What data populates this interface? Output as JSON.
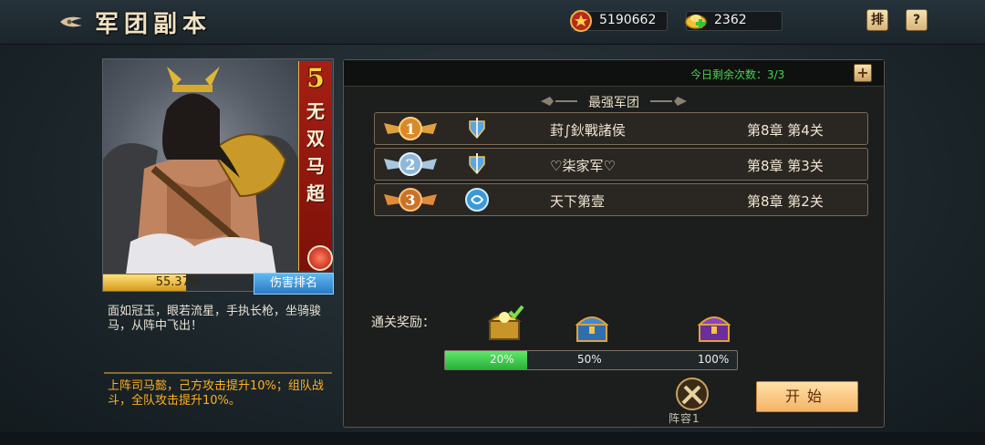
{
  "header": {
    "title": "军团副本",
    "resources": [
      {
        "icon": "rank-medal-icon",
        "value": "5190662"
      },
      {
        "icon": "gold-ingot-plus-icon",
        "value": "2362"
      }
    ],
    "buttons": {
      "rank": "排",
      "help": "?"
    }
  },
  "hero": {
    "rank_number": "5",
    "name": "无双马超",
    "damage_progress_percent": 55.37,
    "damage_text": "55.37%",
    "damage_rank_button": "伤害排名",
    "description": "面如冠玉，眼若流星，手执长枪，坐骑骏马，从阵中飞出！",
    "bonus": "上阵司马懿，己方攻击提升10%；组队战斗，全队攻击提升10%。"
  },
  "panel": {
    "remaining_label": "今日剩余次数：3/3",
    "add_button": "+",
    "section_title": "最强军团",
    "rankings": [
      {
        "rank": "1",
        "name": "葑∫鈥戰諸侯",
        "stage": "第8章 第4关",
        "medal_color": "#d9892c"
      },
      {
        "rank": "2",
        "name": "♡柒家军♡",
        "stage": "第8章 第3关",
        "medal_color": "#8fb8d8"
      },
      {
        "rank": "3",
        "name": "天下第壹",
        "stage": "第8章 第2关",
        "medal_color": "#c9722a"
      }
    ],
    "reward_label": "通关奖励：",
    "reward_progress_percent": 20,
    "reward_marks": [
      "20%",
      "50%",
      "100%"
    ],
    "lineup_label": "阵容1",
    "start_button": "开始"
  },
  "colors": {
    "accent_green": "#46d24a",
    "bonus_orange": "#ffb020",
    "start_button": "#f5b466"
  }
}
